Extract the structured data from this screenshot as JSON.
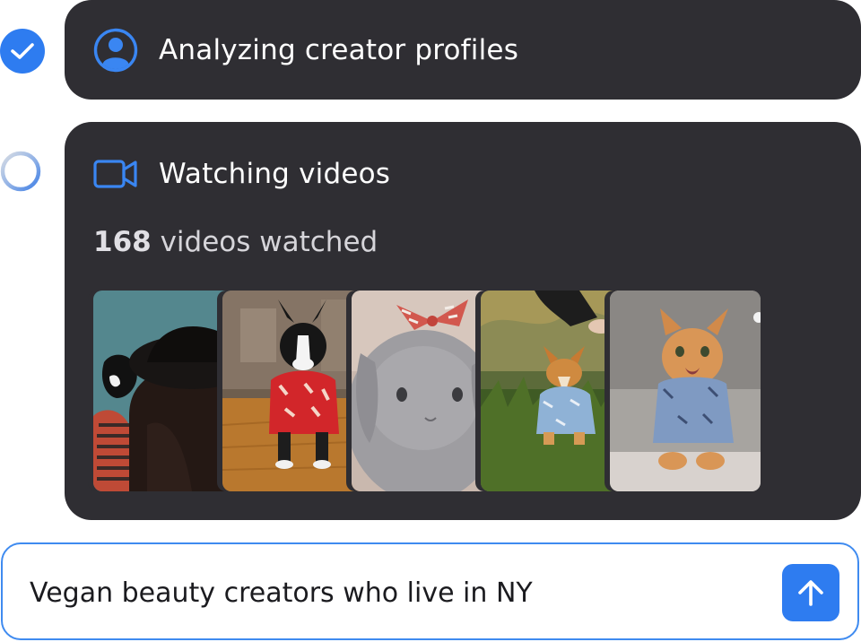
{
  "steps": [
    {
      "status": "complete",
      "status_icon": "check-icon",
      "icon": "user-profile-icon",
      "title": "Analyzing creator profiles"
    },
    {
      "status": "in-progress",
      "status_icon": "spinner-icon",
      "icon": "video-camera-icon",
      "title": "Watching videos",
      "progress": {
        "count": "168",
        "label": " videos watched"
      },
      "thumbnails": [
        {
          "icon": "video-thumbnail",
          "subject": "cat-on-shoulder"
        },
        {
          "icon": "video-thumbnail",
          "subject": "dog-in-red-shirt"
        },
        {
          "icon": "video-thumbnail",
          "subject": "rabbit-with-bow"
        },
        {
          "icon": "video-thumbnail",
          "subject": "corgi-in-grass"
        },
        {
          "icon": "video-thumbnail",
          "subject": "cat-in-shirt"
        }
      ]
    }
  ],
  "prompt": {
    "value": "Vegan beauty creators who live in NY",
    "send_icon": "arrow-up-icon"
  },
  "colors": {
    "accent": "#2e7cf0",
    "card_bg": "#2f2e33",
    "input_border": "#3f8bf0"
  }
}
